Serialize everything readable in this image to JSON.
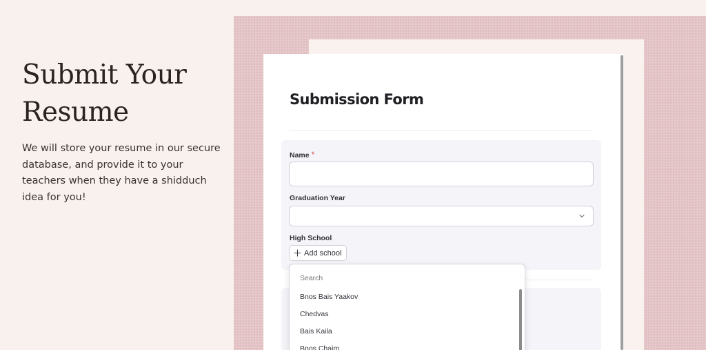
{
  "hero": {
    "title_line1": "Submit Your",
    "title_line2": "Resume",
    "description": "We will store your resume in our secure database, and provide it to your teachers when they have a shidduch idea for you!"
  },
  "form": {
    "title": "Submission Form",
    "name_label": "Name",
    "required_mark": "*",
    "name_value": "",
    "grad_year_label": "Graduation Year",
    "grad_year_value": "",
    "high_school_label": "High School",
    "add_school_label": "Add school"
  },
  "dropdown": {
    "search_placeholder": "Search",
    "options": [
      "Bnos Bais Yaakov",
      "Chedvas",
      "Bais Kaila",
      "Bnos Chaim"
    ]
  },
  "colors": {
    "page_bg": "#f8f1ee",
    "panel_pink": "#e6c8cb",
    "required": "#d9534f"
  }
}
